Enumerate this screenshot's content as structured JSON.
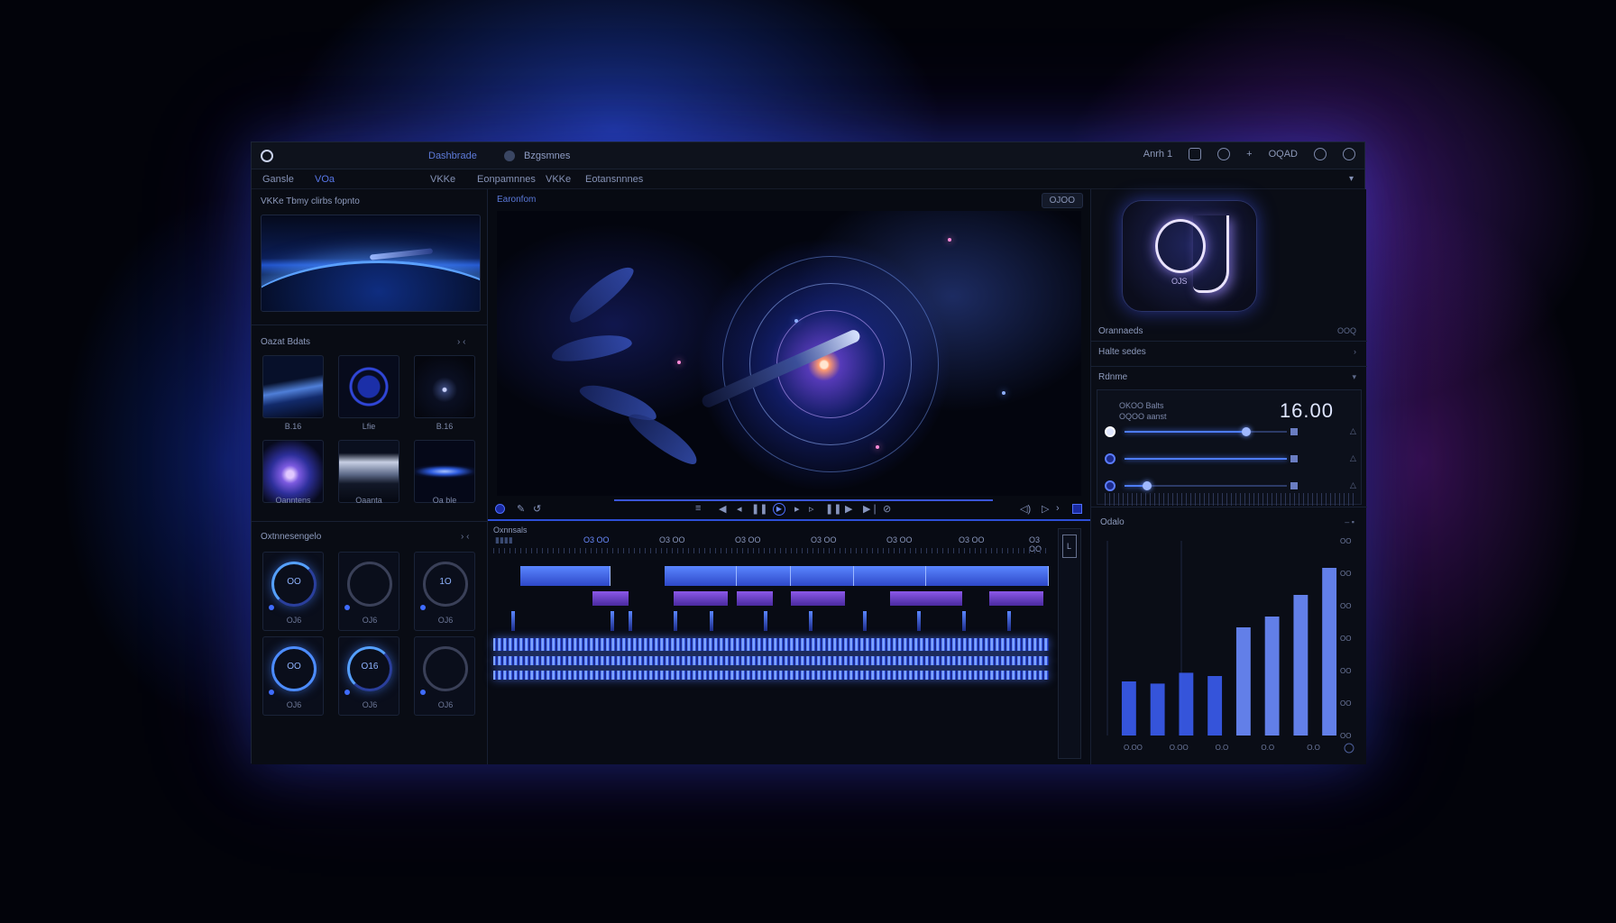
{
  "titlebar": {
    "app_title": "Dashbrade",
    "project_name": "Bzgsmnes",
    "right_label": "Anrh 1",
    "right_extra": "OQAD"
  },
  "menubar": {
    "items": [
      "Gansle",
      "VOa",
      "VKKe",
      "Eonpamnnes",
      "VKKe",
      "Eotansnnnes"
    ]
  },
  "left": {
    "hero_title": "VKKe Tbmy clirbs fopnto",
    "section2_title": "Oazat Bdats",
    "section2_ctrl": "› ‹",
    "grid_labels": [
      "B.16",
      "Lfie",
      "B.16",
      "Oanntens",
      "Oaanta",
      "Oa ble"
    ],
    "section3_title": "Oxtnnesengelo",
    "section3_ctrl": "› ‹",
    "gauges": [
      {
        "text": "OO",
        "value": "OJ6"
      },
      {
        "text": "",
        "value": "OJ6"
      },
      {
        "text": "1O",
        "value": "OJ6"
      },
      {
        "text": "OO",
        "value": "OJ6"
      },
      {
        "text": "O16",
        "value": "OJ6"
      },
      {
        "text": "",
        "value": "OJ6"
      }
    ]
  },
  "center": {
    "preview_label": "Earonfom",
    "preview_counter": "OJOO",
    "timeline_label": "Oxnnsals",
    "ruler": [
      "O3.OO",
      "O3 OO",
      "O3 OO",
      "O3 OO",
      "O3 OO",
      "O3 OO",
      "O3 OO",
      "O3 OO",
      "O3 OO"
    ]
  },
  "right": {
    "logo_sub": "OJS",
    "row1_label": "Orannaeds",
    "row1_tail": "OOQ",
    "row2_label": "Halte sedes",
    "row3_label": "Rdnme",
    "small_line1": "OKOO Balts",
    "small_line2": "OQOO aanst",
    "big_number": "16.00",
    "slider_value": 0.75,
    "slider2_value": 1.0,
    "slider3_value": 0.14,
    "chart_title": "Odalo"
  },
  "chart_data": {
    "type": "bar",
    "categories": [
      "O.O",
      "O.O",
      "O.O",
      "O.O",
      "O.O"
    ],
    "y_tick_labels": [
      "OO",
      "OO",
      "OO",
      "OO",
      "OO",
      "OO",
      "OO"
    ],
    "series": [
      {
        "values": [
          50,
          48,
          58,
          55,
          100,
          110,
          130,
          155
        ]
      }
    ],
    "x_labels": [
      "O.OO",
      "O.OO",
      "O.O",
      "O.O",
      "O.O"
    ],
    "ylim": [
      0,
      180
    ],
    "colors": {
      "bar": "#3a5cf0",
      "highlight": "#6b8cff"
    }
  },
  "colors": {
    "accent": "#4d7cff",
    "purple": "#8b58e8",
    "background": "#0b0e17"
  }
}
